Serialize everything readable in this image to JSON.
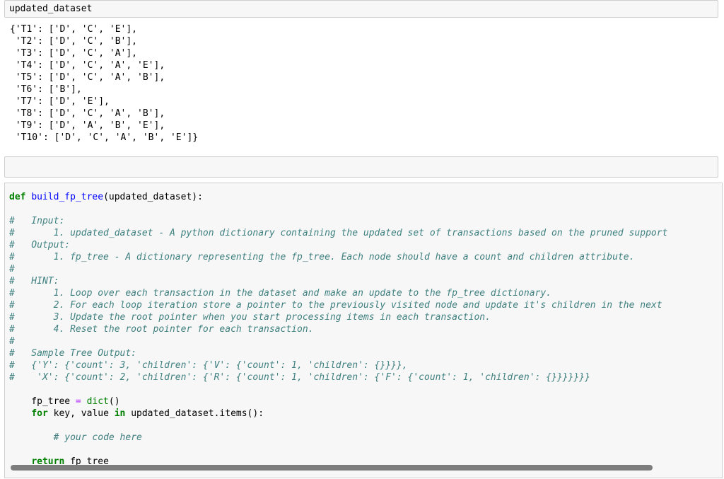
{
  "cell1": {
    "input": "updated_dataset"
  },
  "output1": {
    "lines": [
      "{'T1': ['D', 'C', 'E'],",
      " 'T2': ['D', 'C', 'B'],",
      " 'T3': ['D', 'C', 'A'],",
      " 'T4': ['D', 'C', 'A', 'E'],",
      " 'T5': ['D', 'C', 'A', 'B'],",
      " 'T6': ['B'],",
      " 'T7': ['D', 'E'],",
      " 'T8': ['D', 'C', 'A', 'B'],",
      " 'T9': ['D', 'A', 'B', 'E'],",
      " 'T10': ['D', 'C', 'A', 'B', 'E']}"
    ]
  },
  "cell2": {
    "input": ""
  },
  "cell3": {
    "def_kw": "def",
    "func_name": "build_fp_tree",
    "func_args": "(updated_dataset):",
    "comments": [
      "#   Input:",
      "#       1. updated_dataset - A python dictionary containing the updated set of transactions based on the pruned support",
      "#   Output:",
      "#       1. fp_tree - A dictionary representing the fp_tree. Each node should have a count and children attribute.",
      "#",
      "#   HINT:",
      "#       1. Loop over each transaction in the dataset and make an update to the fp_tree dictionary.",
      "#       2. For each loop iteration store a pointer to the previously visited node and update it's children in the next",
      "#       3. Update the root pointer when you start processing items in each transaction.",
      "#       4. Reset the root pointer for each transaction.",
      "#",
      "#   Sample Tree Output:",
      "#   {'Y': {'count': 3, 'children': {'V': {'count': 1, 'children': {}}}},",
      "#    'X': {'count': 2, 'children': {'R': {'count': 1, 'children': {'F': {'count': 1, 'children': {}}}}}}}"
    ],
    "line_fp_tree_var": "    fp_tree ",
    "line_fp_tree_eq": "=",
    "line_fp_tree_rhs": " dict()",
    "line_dict": "dict",
    "line_for_kw": "for",
    "line_for_rest": " key, value ",
    "line_in_kw": "in",
    "line_for_tail": " updated_dataset.items():",
    "your_code_comment": "# your code here",
    "return_kw": "return",
    "return_rest": " fp_tree"
  }
}
